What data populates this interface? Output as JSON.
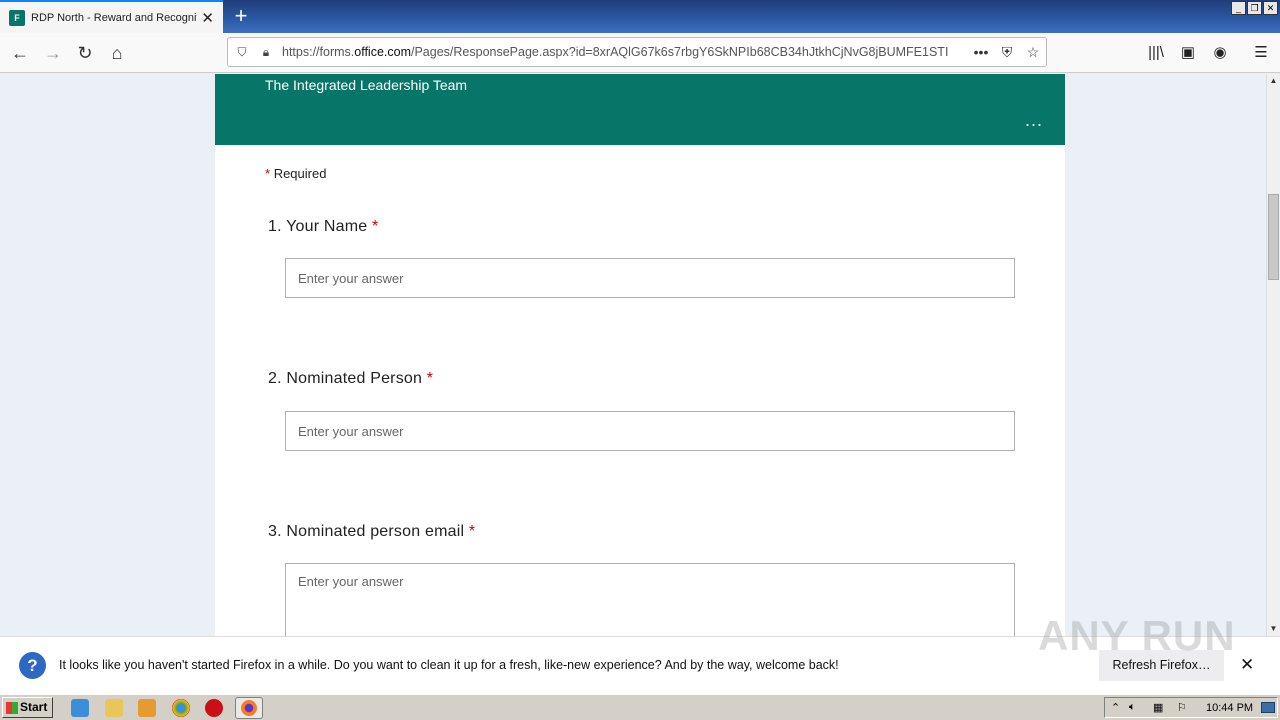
{
  "browser": {
    "tab_title": "RDP North - Reward and Recognition",
    "tab_favicon_label": "F",
    "url_prefix": "https://forms.",
    "url_domain": "office.com",
    "url_path": "/Pages/ResponsePage.aspx?id=8xrAQlG67k6s7rbgY6SkNPIb68CB34hJtkhCjNvG8jBUMFE1STI"
  },
  "form": {
    "subtitle": "The Integrated Leadership Team",
    "menu_dots": "...",
    "required_star": "*",
    "required_label": "Required",
    "questions": [
      {
        "label": "1. Your Name",
        "star": "*",
        "placeholder": "Enter your answer"
      },
      {
        "label": "2. Nominated Person",
        "star": "*",
        "placeholder": "Enter your answer"
      },
      {
        "label": "3. Nominated person email",
        "star": "*",
        "placeholder": "Enter your answer"
      }
    ]
  },
  "notification": {
    "message": "It looks like you haven't started Firefox in a while. Do you want to clean it up for a fresh, like-new experience? And by the way, welcome back!",
    "button": "Refresh Firefox…"
  },
  "watermark": "ANY RUN",
  "taskbar": {
    "start_label": "Start",
    "clock": "10:44 PM"
  },
  "colors": {
    "form_header": "#077568",
    "accent": "#0a84ff"
  }
}
